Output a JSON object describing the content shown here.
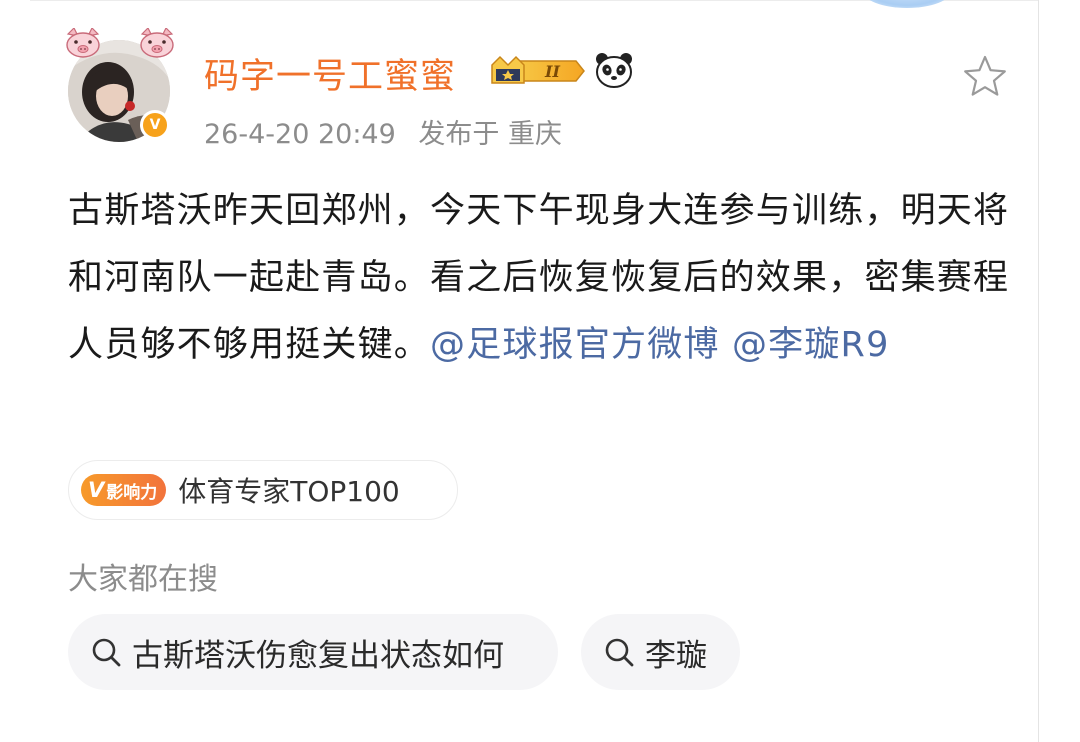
{
  "post": {
    "author": {
      "name": "码字一号工蜜蜜",
      "level_badge": "II",
      "verified_mark": "V"
    },
    "timestamp": "26-4-20 20:49",
    "location_label": "发布于 重庆",
    "content_text": "古斯塔沃昨天回郑州，今天下午现身大连参与训练，明天将和河南队一起赴青岛。看之后恢复恢复后的效果，密集赛程人员够不够用挺关键。",
    "mentions": [
      "@足球报官方微博",
      "@李璇R9"
    ],
    "influence": {
      "badge_label": "影响力",
      "badge_mark": "V",
      "tag_text": "体育专家TOP100"
    }
  },
  "hot_search": {
    "title": "大家都在搜",
    "items": [
      {
        "text": "古斯塔沃伤愈复出状态如何",
        "icon": "search-icon"
      },
      {
        "text": "李璇",
        "icon": "search-icon"
      }
    ]
  },
  "icons": {
    "favorite": "star-outline-icon",
    "avatar_decoration": "pig-face-icon",
    "fan_badge": "crown-badge-icon",
    "pet_badge": "panda-icon"
  },
  "colors": {
    "username": "#f0712a",
    "mention": "#4c6aa3",
    "meta": "#8c8c8c",
    "badge_orange": "#f7a21b"
  }
}
